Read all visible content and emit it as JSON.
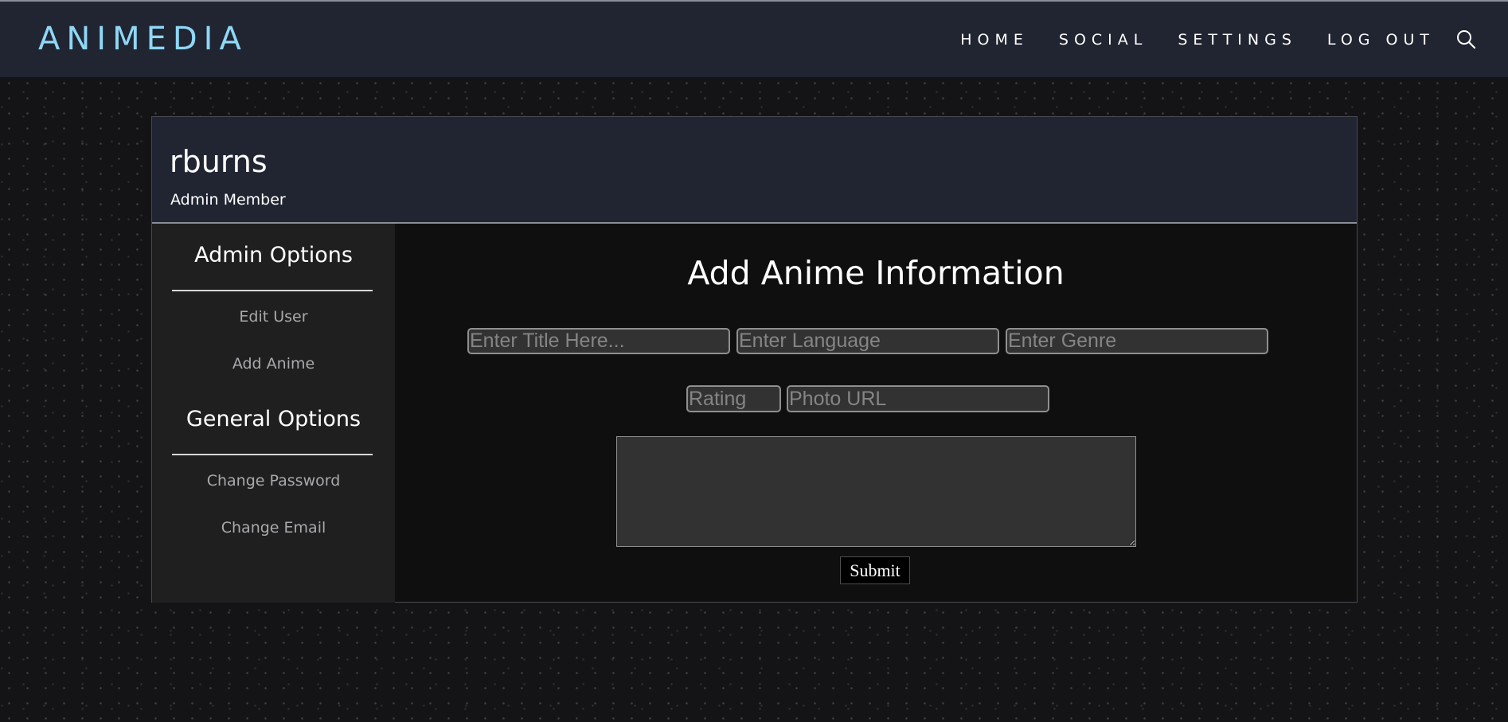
{
  "navbar": {
    "brand": "ANIMEDIA",
    "links": [
      "HOME",
      "SOCIAL",
      "SETTINGS",
      "LOG OUT"
    ],
    "search_icon": "search-icon"
  },
  "profile": {
    "username": "rburns",
    "role": "Admin Member"
  },
  "sidebar": {
    "admin_heading": "Admin Options",
    "admin_links": [
      "Edit User",
      "Add Anime"
    ],
    "general_heading": "General Options",
    "general_links": [
      "Change Password",
      "Change Email"
    ]
  },
  "form": {
    "title": "Add Anime Information",
    "title_placeholder": "Enter Title Here...",
    "language_placeholder": "Enter Language",
    "genre_placeholder": "Enter Genre",
    "rating_placeholder": "Rating",
    "photo_placeholder": "Photo URL",
    "description_value": "",
    "submit_label": "Submit"
  },
  "colors": {
    "brand": "#8fd7f6",
    "navbar_bg": "#212532",
    "sidebar_bg": "#1f1f20",
    "input_bg": "#323232"
  }
}
